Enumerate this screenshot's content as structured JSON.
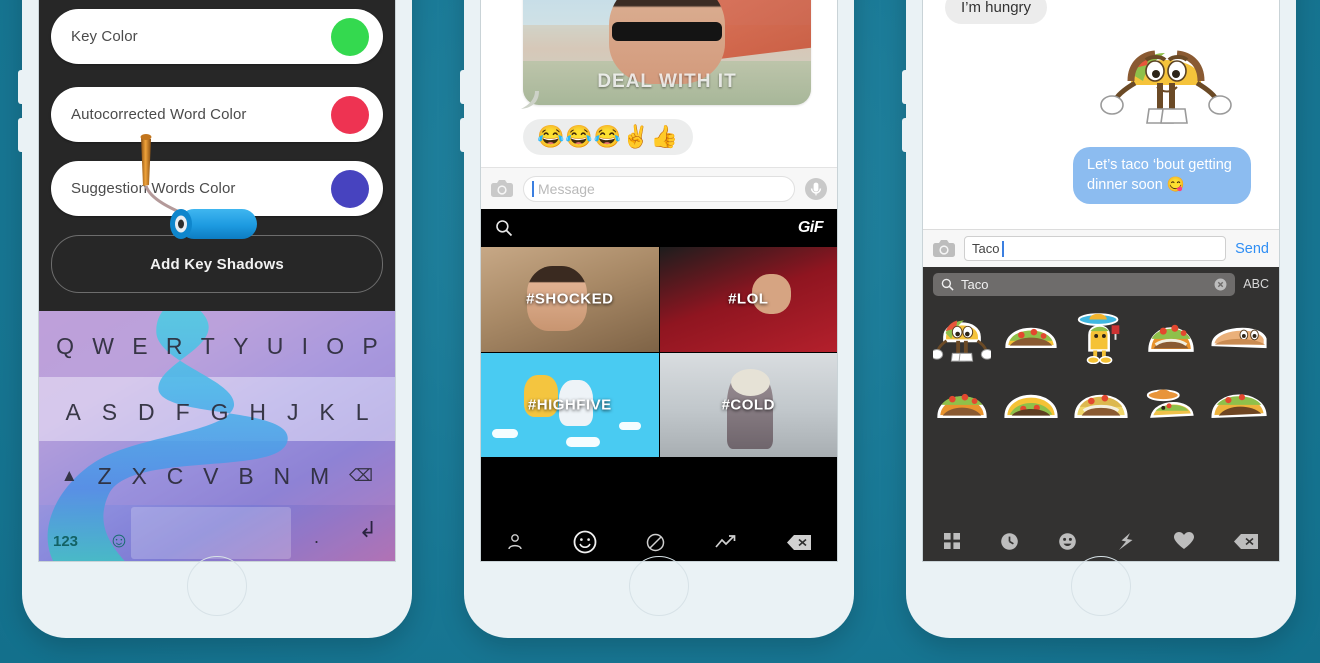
{
  "background": {
    "color": "#1a7a97"
  },
  "phone1": {
    "name": "keyboard-theme-settings",
    "settings": [
      {
        "label": "Key Color",
        "color": "#34d94f"
      },
      {
        "label": "Autocorrected Word Color",
        "color": "#ee3352"
      },
      {
        "label": "Suggestion Words Color",
        "color": "#4743bf"
      }
    ],
    "shadow_button": "Add Key Shadows",
    "keyboard": {
      "row1": [
        "Q",
        "W",
        "E",
        "R",
        "T",
        "Y",
        "U",
        "I",
        "O",
        "P"
      ],
      "row2": [
        "A",
        "S",
        "D",
        "F",
        "G",
        "H",
        "J",
        "K",
        "L"
      ],
      "row3": [
        "Z",
        "X",
        "C",
        "V",
        "B",
        "N",
        "M"
      ],
      "shift_icon": "shift-arrow",
      "backspace_icon": "backspace",
      "numbers_key": "123",
      "emoji_key": "☺",
      "period_key": ".",
      "return_icon": "return-arrow"
    }
  },
  "phone2": {
    "name": "messages-gif-picker",
    "gif_message": {
      "caption": "DEAL WITH IT"
    },
    "emoji_reply": "😂😂😂✌👍",
    "input": {
      "placeholder": "Message",
      "camera_icon": "camera",
      "mic_icon": "microphone"
    },
    "picker": {
      "search_icon": "search",
      "logo": "GiF",
      "tiles": [
        {
          "caption": "#SHOCKED"
        },
        {
          "caption": "#LOL"
        },
        {
          "caption": "#HIGHFIVE"
        },
        {
          "caption": "#COLD"
        }
      ],
      "nav": [
        "contacts-icon",
        "emoji-icon",
        "nope-icon",
        "trending-icon",
        "backspace-icon"
      ]
    }
  },
  "phone3": {
    "name": "messages-sticker-picker",
    "messages": [
      {
        "from": "them",
        "text": "I’m hungry"
      },
      {
        "from": "me",
        "text": "Let’s taco ‘bout getting dinner soon 😋"
      }
    ],
    "sticker_sent": "taco-character-sticker",
    "input": {
      "value": "Taco",
      "camera_icon": "camera",
      "send_label": "Send"
    },
    "picker": {
      "search_icon": "search",
      "search_value": "Taco",
      "clear_icon": "clear",
      "abc_label": "ABC",
      "stickers": [
        "taco-character",
        "taco-open",
        "taco-mariachi",
        "taco-loaded",
        "taco-face-right",
        "taco-shell",
        "taco-yellow",
        "taco-crunchy",
        "taco-sombrero",
        "taco-meat"
      ],
      "nav": [
        "grid-icon",
        "recent-icon",
        "emoji-icon",
        "flash-icon",
        "heart-icon",
        "backspace-icon"
      ]
    }
  }
}
